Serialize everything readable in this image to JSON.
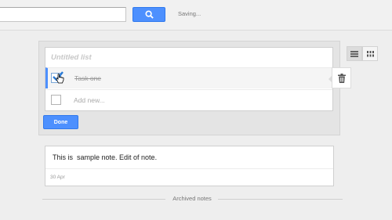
{
  "header": {
    "search_value": "",
    "status_text": "Saving..."
  },
  "note_editor": {
    "title_placeholder": "Untitled list",
    "items": [
      {
        "label": "Task one",
        "checked": true
      }
    ],
    "add_placeholder": "Add new...",
    "done_label": "Done"
  },
  "notes": [
    {
      "body": "This is  sample note. Edit of note.",
      "date": "30 Apr"
    }
  ],
  "archived": {
    "label": "Archived notes"
  },
  "icons": {
    "search": "search-icon",
    "trash": "trash-icon",
    "list_view": "list-view-icon",
    "grid_view": "grid-view-icon",
    "cursor": "hand-cursor-icon"
  },
  "colors": {
    "accent": "#4d90fe",
    "background": "#eeeeee"
  }
}
